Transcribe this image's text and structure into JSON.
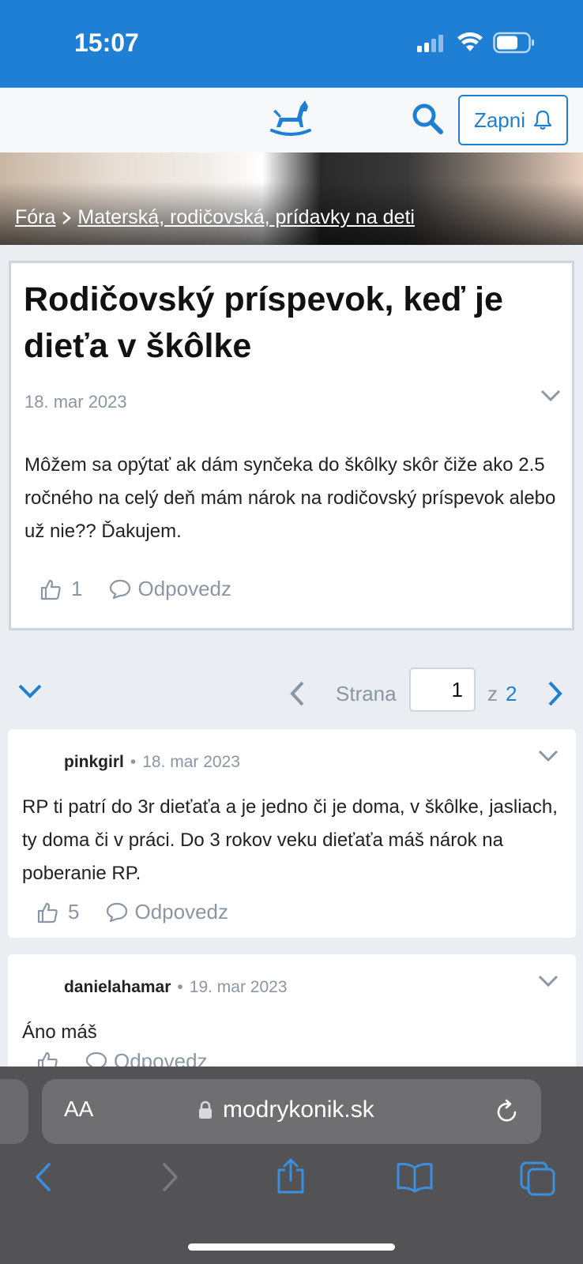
{
  "status_bar": {
    "time": "15:07"
  },
  "header": {
    "notify_label": "Zapni"
  },
  "breadcrumb": {
    "root": "Fóra",
    "category": "Materská, rodičovská, prídavky na deti"
  },
  "post": {
    "title": "Rodičovský príspevok, keď je dieťa v škôlke",
    "date": "18. mar 2023",
    "body": "Môžem sa opýtať ak dám synčeka do škôlky skôr čiže ako 2.5 ročného na celý deň mám nárok na rodičovský príspevok alebo už nie?? Ďakujem.",
    "likes": "1",
    "reply_label": "Odpovedz"
  },
  "pagination": {
    "label": "Strana",
    "current": "1",
    "of_label": "z",
    "total": "2"
  },
  "comments": [
    {
      "user": "pinkgirl",
      "date": "18. mar 2023",
      "text": "RP ti patrí do 3r dieťaťa a je jedno či je doma, v škôlke, jasliach, ty doma či v práci. Do 3 rokov veku dieťaťa máš nárok na poberanie RP.",
      "likes": "5",
      "reply_label": "Odpovedz"
    },
    {
      "user": "danielahamar",
      "date": "19. mar 2023",
      "text": "Áno máš",
      "likes": "",
      "reply_label": "Odpovedz"
    }
  ],
  "browser": {
    "text_size_label": "AA",
    "domain": "modrykonik.sk"
  },
  "colors": {
    "brand": "#1f7fd4",
    "muted": "#8a96a3",
    "browser_chrome": "#535355"
  }
}
